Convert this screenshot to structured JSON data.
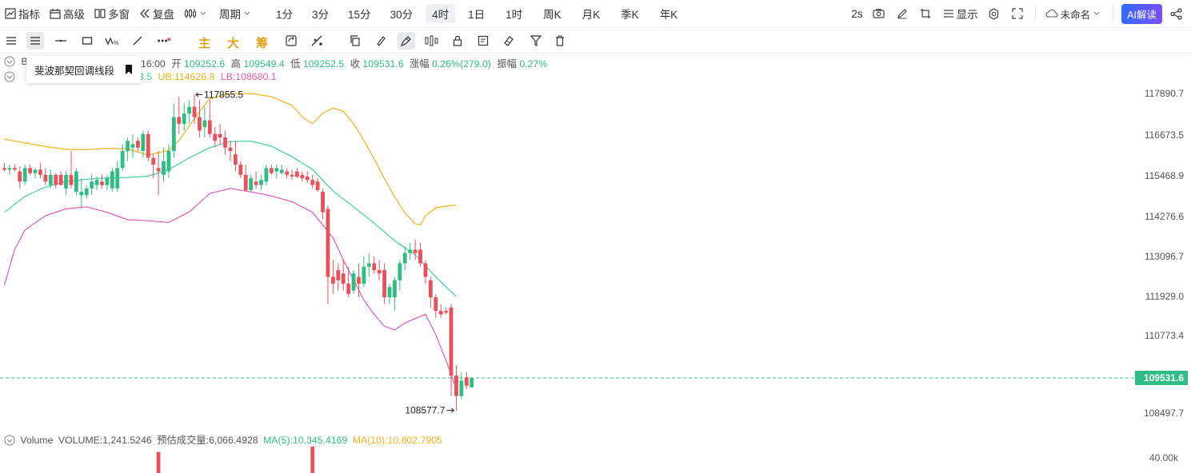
{
  "toolbar": {
    "indicators": "指标",
    "advanced": "高级",
    "multiwindow": "多窗",
    "replay": "复盘",
    "period_label": "周期",
    "periods": [
      "1分",
      "3分",
      "15分",
      "30分",
      "4时",
      "1日",
      "1时",
      "周K",
      "月K",
      "季K",
      "年K"
    ],
    "active_period": "4时",
    "refresh": "2s",
    "display": "显示",
    "layout_name": "未命名",
    "ai_button": "AI解读"
  },
  "drawbar": {
    "main": "主",
    "big": "大",
    "chip": "筹",
    "tooltip": "斐波那契回调线段"
  },
  "ohlc": {
    "symbol_prefix": "B",
    "time": "16:00",
    "open_label": "开",
    "open": "109252.6",
    "high_label": "高",
    "high": "109549.4",
    "low_label": "低",
    "low": "109252.5",
    "close_label": "收",
    "close": "109531.6",
    "change_label": "涨幅",
    "change": "0.26%(279.0)",
    "amp_label": "振幅",
    "amp": "0.27%"
  },
  "boll": {
    "mid_partial": "3.5",
    "ub": "UB:114626.8",
    "lb": "LB:108680.1"
  },
  "volume": {
    "label": "Volume",
    "volume_text": "VOLUME:1,241.5246",
    "estimate_text": "预估成交量:6,066.4928",
    "ma5_text": "MA(5):10,345.4169",
    "ma10_text": "MA(10):10,802.7905",
    "axis_label": "40.00k"
  },
  "colors": {
    "up": "#2ebd85",
    "down": "#e8505b",
    "ub": "#f0b21a",
    "mid": "#3fd0a4",
    "lb": "#e05bb0",
    "price_tag": "#2ebd85"
  },
  "chart_data": {
    "type": "candlestick",
    "y_ticks": [
      "117890.7",
      "116673.5",
      "115468.9",
      "114276.6",
      "113096.7",
      "111929.0",
      "110773.4",
      "109531.6",
      "108497.7"
    ],
    "last_price": "109531.6",
    "high_marker": "117855.5",
    "low_marker": "108577.7",
    "candles": [
      {
        "o": 115700,
        "h": 115850,
        "l": 115600,
        "c": 115650
      },
      {
        "o": 115650,
        "h": 115800,
        "l": 115500,
        "c": 115700
      },
      {
        "o": 115700,
        "h": 115800,
        "l": 115600,
        "c": 115650
      },
      {
        "o": 115600,
        "h": 115750,
        "l": 115100,
        "c": 115300
      },
      {
        "o": 115300,
        "h": 115800,
        "l": 115200,
        "c": 115700
      },
      {
        "o": 115700,
        "h": 115800,
        "l": 115500,
        "c": 115550
      },
      {
        "o": 115550,
        "h": 115700,
        "l": 115400,
        "c": 115650
      },
      {
        "o": 115650,
        "h": 115850,
        "l": 115400,
        "c": 115500
      },
      {
        "o": 115500,
        "h": 115700,
        "l": 115200,
        "c": 115300
      },
      {
        "o": 115200,
        "h": 115650,
        "l": 115100,
        "c": 115500
      },
      {
        "o": 115500,
        "h": 115550,
        "l": 115100,
        "c": 115200
      },
      {
        "o": 115500,
        "h": 115600,
        "l": 115200,
        "c": 115200
      },
      {
        "o": 115100,
        "h": 115600,
        "l": 114900,
        "c": 115500
      },
      {
        "o": 115500,
        "h": 116200,
        "l": 115100,
        "c": 115200
      },
      {
        "o": 115000,
        "h": 115700,
        "l": 114900,
        "c": 115600
      },
      {
        "o": 114900,
        "h": 115400,
        "l": 114500,
        "c": 115000
      },
      {
        "o": 114900,
        "h": 115200,
        "l": 114800,
        "c": 115100
      },
      {
        "o": 115100,
        "h": 115500,
        "l": 114900,
        "c": 115300
      },
      {
        "o": 115200,
        "h": 115450,
        "l": 115050,
        "c": 115350
      },
      {
        "o": 115300,
        "h": 115500,
        "l": 115100,
        "c": 115200
      },
      {
        "o": 115200,
        "h": 115500,
        "l": 115050,
        "c": 115400
      },
      {
        "o": 115100,
        "h": 115700,
        "l": 115000,
        "c": 115600
      },
      {
        "o": 115100,
        "h": 115900,
        "l": 115000,
        "c": 115700
      },
      {
        "o": 115700,
        "h": 116400,
        "l": 115600,
        "c": 116200
      },
      {
        "o": 116200,
        "h": 116600,
        "l": 115900,
        "c": 116500
      },
      {
        "o": 116300,
        "h": 116700,
        "l": 116000,
        "c": 116400
      },
      {
        "o": 116500,
        "h": 116600,
        "l": 116200,
        "c": 116300
      },
      {
        "o": 116200,
        "h": 116800,
        "l": 116000,
        "c": 116700
      },
      {
        "o": 116700,
        "h": 116800,
        "l": 115900,
        "c": 116000
      },
      {
        "o": 116000,
        "h": 116100,
        "l": 115400,
        "c": 115800
      },
      {
        "o": 115700,
        "h": 116200,
        "l": 114900,
        "c": 115600
      },
      {
        "o": 115500,
        "h": 116300,
        "l": 115300,
        "c": 115900
      },
      {
        "o": 115600,
        "h": 116400,
        "l": 115400,
        "c": 116200
      },
      {
        "o": 116200,
        "h": 117600,
        "l": 116000,
        "c": 117200
      },
      {
        "o": 117200,
        "h": 117800,
        "l": 116700,
        "c": 117000
      },
      {
        "o": 117000,
        "h": 117600,
        "l": 116800,
        "c": 117300
      },
      {
        "o": 117300,
        "h": 117700,
        "l": 117000,
        "c": 117500
      },
      {
        "o": 117500,
        "h": 117856,
        "l": 117000,
        "c": 117200
      },
      {
        "o": 117200,
        "h": 117700,
        "l": 116600,
        "c": 116800
      },
      {
        "o": 116900,
        "h": 117500,
        "l": 116600,
        "c": 117100
      },
      {
        "o": 117100,
        "h": 117700,
        "l": 116600,
        "c": 116700
      },
      {
        "o": 116700,
        "h": 116900,
        "l": 116300,
        "c": 116500
      },
      {
        "o": 116700,
        "h": 117000,
        "l": 116400,
        "c": 116600
      },
      {
        "o": 116600,
        "h": 116800,
        "l": 116100,
        "c": 116300
      },
      {
        "o": 116300,
        "h": 116500,
        "l": 115900,
        "c": 116200
      },
      {
        "o": 116100,
        "h": 116500,
        "l": 115600,
        "c": 115800
      },
      {
        "o": 115800,
        "h": 115900,
        "l": 115400,
        "c": 115500
      },
      {
        "o": 115500,
        "h": 115800,
        "l": 115000,
        "c": 115050
      },
      {
        "o": 115050,
        "h": 115500,
        "l": 115000,
        "c": 115400
      },
      {
        "o": 115300,
        "h": 115600,
        "l": 115100,
        "c": 115200
      },
      {
        "o": 115200,
        "h": 115500,
        "l": 115050,
        "c": 115350
      },
      {
        "o": 115300,
        "h": 115800,
        "l": 115200,
        "c": 115700
      },
      {
        "o": 115700,
        "h": 115800,
        "l": 115500,
        "c": 115550
      },
      {
        "o": 115600,
        "h": 115800,
        "l": 115400,
        "c": 115700
      },
      {
        "o": 115550,
        "h": 115800,
        "l": 115500,
        "c": 115650
      },
      {
        "o": 115600,
        "h": 115700,
        "l": 115400,
        "c": 115500
      },
      {
        "o": 115500,
        "h": 115650,
        "l": 115350,
        "c": 115450
      },
      {
        "o": 115600,
        "h": 115700,
        "l": 115400,
        "c": 115450
      },
      {
        "o": 115500,
        "h": 115600,
        "l": 115300,
        "c": 115400
      },
      {
        "o": 115450,
        "h": 115600,
        "l": 115250,
        "c": 115350
      },
      {
        "o": 115350,
        "h": 115500,
        "l": 115100,
        "c": 115200
      },
      {
        "o": 115300,
        "h": 115400,
        "l": 115000,
        "c": 115050
      },
      {
        "o": 115000,
        "h": 115100,
        "l": 114200,
        "c": 114400
      },
      {
        "o": 114500,
        "h": 114600,
        "l": 111700,
        "c": 112500
      },
      {
        "o": 112500,
        "h": 113000,
        "l": 112000,
        "c": 112300
      },
      {
        "o": 112700,
        "h": 112900,
        "l": 112100,
        "c": 112400
      },
      {
        "o": 112600,
        "h": 113000,
        "l": 112100,
        "c": 112300
      },
      {
        "o": 112300,
        "h": 112800,
        "l": 111900,
        "c": 112000
      },
      {
        "o": 112100,
        "h": 112700,
        "l": 112000,
        "c": 112600
      },
      {
        "o": 112500,
        "h": 112900,
        "l": 111900,
        "c": 112300
      },
      {
        "o": 112300,
        "h": 113100,
        "l": 112200,
        "c": 112800
      },
      {
        "o": 112800,
        "h": 113200,
        "l": 112500,
        "c": 112900
      },
      {
        "o": 112900,
        "h": 113100,
        "l": 112600,
        "c": 112700
      },
      {
        "o": 112700,
        "h": 113000,
        "l": 112400,
        "c": 112600
      },
      {
        "o": 112700,
        "h": 112900,
        "l": 111700,
        "c": 111900
      },
      {
        "o": 111900,
        "h": 112300,
        "l": 111700,
        "c": 112200
      },
      {
        "o": 111900,
        "h": 112500,
        "l": 111500,
        "c": 112400
      },
      {
        "o": 112400,
        "h": 113000,
        "l": 112100,
        "c": 112900
      },
      {
        "o": 112900,
        "h": 113400,
        "l": 112700,
        "c": 113200
      },
      {
        "o": 113200,
        "h": 113500,
        "l": 113000,
        "c": 113300
      },
      {
        "o": 113300,
        "h": 113600,
        "l": 113000,
        "c": 113200
      },
      {
        "o": 113300,
        "h": 113500,
        "l": 112800,
        "c": 112900
      },
      {
        "o": 112900,
        "h": 113000,
        "l": 112300,
        "c": 112500
      },
      {
        "o": 112400,
        "h": 112500,
        "l": 111600,
        "c": 111900
      },
      {
        "o": 111900,
        "h": 112000,
        "l": 111300,
        "c": 111500
      },
      {
        "o": 111500,
        "h": 111700,
        "l": 111300,
        "c": 111400
      },
      {
        "o": 111500,
        "h": 111600,
        "l": 111400,
        "c": 111450
      },
      {
        "o": 111600,
        "h": 111700,
        "l": 109000,
        "c": 109600
      },
      {
        "o": 109600,
        "h": 109900,
        "l": 108578,
        "c": 109000
      },
      {
        "o": 109000,
        "h": 109700,
        "l": 108900,
        "c": 109450
      },
      {
        "o": 109550,
        "h": 109700,
        "l": 109200,
        "c": 109300
      },
      {
        "o": 109252.6,
        "h": 109549.4,
        "l": 109252.5,
        "c": 109531.6
      }
    ],
    "ub_line": [
      [
        0,
        116550
      ],
      [
        4,
        116440
      ],
      [
        8,
        116330
      ],
      [
        12,
        116250
      ],
      [
        16,
        116240
      ],
      [
        20,
        116280
      ],
      [
        24,
        116260
      ],
      [
        28,
        116080
      ],
      [
        32,
        116220
      ],
      [
        34,
        116510
      ],
      [
        36,
        116940
      ],
      [
        38,
        117360
      ],
      [
        40,
        117740
      ],
      [
        44,
        117880
      ],
      [
        48,
        117890
      ],
      [
        52,
        117800
      ],
      [
        56,
        117540
      ],
      [
        58,
        117200
      ],
      [
        60,
        117000
      ],
      [
        62,
        117310
      ],
      [
        64,
        117460
      ],
      [
        66,
        117370
      ],
      [
        68,
        117000
      ],
      [
        70,
        116520
      ],
      [
        72,
        115970
      ],
      [
        74,
        115390
      ],
      [
        76,
        114850
      ],
      [
        78,
        114380
      ],
      [
        80,
        114060
      ],
      [
        81,
        114030
      ],
      [
        82,
        114290
      ],
      [
        84,
        114530
      ],
      [
        86,
        114580
      ],
      [
        88,
        114610
      ]
    ],
    "mid_line": [
      [
        0,
        114400
      ],
      [
        4,
        114870
      ],
      [
        8,
        115140
      ],
      [
        12,
        115300
      ],
      [
        16,
        115370
      ],
      [
        20,
        115410
      ],
      [
        24,
        115420
      ],
      [
        28,
        115460
      ],
      [
        32,
        115650
      ],
      [
        36,
        116000
      ],
      [
        40,
        116300
      ],
      [
        44,
        116480
      ],
      [
        48,
        116490
      ],
      [
        52,
        116340
      ],
      [
        56,
        116030
      ],
      [
        60,
        115660
      ],
      [
        64,
        115020
      ],
      [
        68,
        114560
      ],
      [
        72,
        114080
      ],
      [
        76,
        113560
      ],
      [
        80,
        113150
      ],
      [
        84,
        112500
      ],
      [
        88,
        111920
      ]
    ],
    "lb_line": [
      [
        0,
        112260
      ],
      [
        2,
        113300
      ],
      [
        4,
        113880
      ],
      [
        8,
        114300
      ],
      [
        12,
        114500
      ],
      [
        16,
        114560
      ],
      [
        20,
        114400
      ],
      [
        24,
        114180
      ],
      [
        28,
        114150
      ],
      [
        32,
        114100
      ],
      [
        36,
        114410
      ],
      [
        40,
        114950
      ],
      [
        44,
        115100
      ],
      [
        48,
        115000
      ],
      [
        52,
        114880
      ],
      [
        56,
        114710
      ],
      [
        60,
        114400
      ],
      [
        64,
        113650
      ],
      [
        66,
        113000
      ],
      [
        70,
        111820
      ],
      [
        72,
        111400
      ],
      [
        74,
        111050
      ],
      [
        76,
        110940
      ],
      [
        78,
        111150
      ],
      [
        82,
        111400
      ],
      [
        84,
        110800
      ],
      [
        86,
        110050
      ],
      [
        88,
        109200
      ]
    ],
    "volume_bars": [
      {
        "i": 30,
        "v": 32000,
        "dir": "down"
      },
      {
        "i": 60,
        "v": 40000,
        "dir": "down"
      }
    ]
  }
}
